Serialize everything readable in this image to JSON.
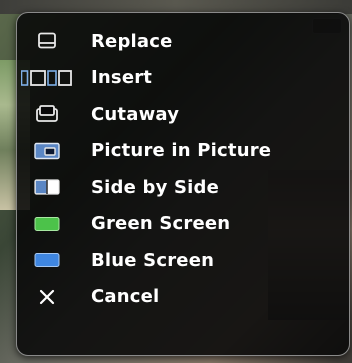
{
  "menu": {
    "items": [
      {
        "id": "replace",
        "label": "Replace",
        "icon": "replace-icon"
      },
      {
        "id": "insert",
        "label": "Insert",
        "icon": "insert-icon"
      },
      {
        "id": "cutaway",
        "label": "Cutaway",
        "icon": "cutaway-icon"
      },
      {
        "id": "picture-in-picture",
        "label": "Picture in Picture",
        "icon": "picture-in-picture-icon"
      },
      {
        "id": "side-by-side",
        "label": "Side by Side",
        "icon": "side-by-side-icon"
      },
      {
        "id": "green-screen",
        "label": "Green Screen",
        "icon": "green-screen-icon"
      },
      {
        "id": "blue-screen",
        "label": "Blue Screen",
        "icon": "blue-screen-icon"
      },
      {
        "id": "cancel",
        "label": "Cancel",
        "icon": "close-icon"
      }
    ]
  },
  "colors": {
    "menu_background": "#080808",
    "menu_border": "#8a8a8a",
    "label_text": "#ffffff",
    "icon_outline": "#e8e8e8",
    "insert_accent": "#7fb0e8",
    "pip_fill": "#5a86c4",
    "green_screen": "#4cc24a",
    "blue_screen": "#3f86e0"
  }
}
